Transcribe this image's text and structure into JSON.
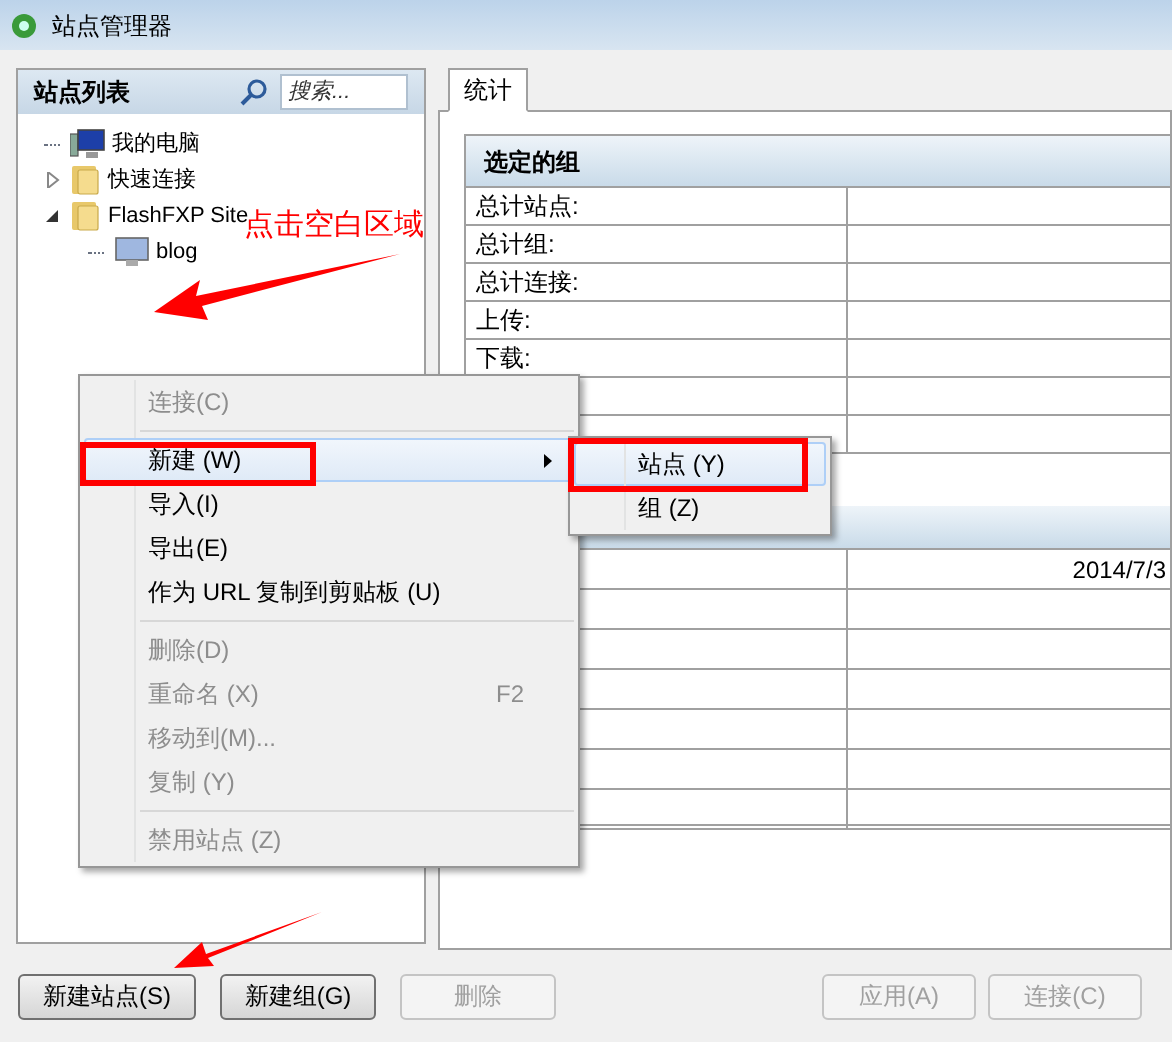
{
  "window": {
    "title": "站点管理器"
  },
  "site_list": {
    "title": "站点列表",
    "search": {
      "placeholder": "搜索..."
    },
    "tree": [
      {
        "label": "我的电脑",
        "kind": "computer"
      },
      {
        "label": "快速连接",
        "kind": "folder",
        "expanded": false
      },
      {
        "label": "FlashFXP Site",
        "kind": "folder",
        "expanded": true,
        "children": [
          {
            "label": "blog",
            "kind": "monitor"
          }
        ]
      }
    ]
  },
  "tabs": [
    {
      "label": "统计",
      "selected": true
    }
  ],
  "stats": {
    "group_title": "选定的组",
    "rows": [
      {
        "label": "总计站点:"
      },
      {
        "label": "总计组:"
      },
      {
        "label": "总计连接:"
      },
      {
        "label": "上传:"
      },
      {
        "label": "下载:"
      }
    ],
    "lower_rows": [
      {
        "value": "2014/7/3"
      }
    ]
  },
  "context_menu": [
    {
      "kind": "item",
      "label": "连接(C)",
      "disabled": true,
      "selected": false
    },
    {
      "kind": "separator"
    },
    {
      "kind": "item",
      "label": "新建 (W)",
      "disabled": false,
      "selected": true,
      "submenu": true
    },
    {
      "kind": "item",
      "label": "导入(I)",
      "disabled": false,
      "selected": false
    },
    {
      "kind": "item",
      "label": "导出(E)",
      "disabled": false,
      "selected": false
    },
    {
      "kind": "item",
      "label": "作为 URL 复制到剪贴板 (U)",
      "disabled": false,
      "selected": false
    },
    {
      "kind": "separator"
    },
    {
      "kind": "item",
      "label": "删除(D)",
      "disabled": true,
      "selected": false
    },
    {
      "kind": "item",
      "label": "重命名 (X)",
      "disabled": true,
      "selected": false,
      "shortcut": "F2"
    },
    {
      "kind": "item",
      "label": "移动到(M)...",
      "disabled": true,
      "selected": false
    },
    {
      "kind": "item",
      "label": "复制 (Y)",
      "disabled": true,
      "selected": false
    },
    {
      "kind": "separator"
    },
    {
      "kind": "item",
      "label": "禁用站点 (Z)",
      "disabled": true,
      "selected": false
    }
  ],
  "submenu": [
    {
      "label": "站点 (Y)",
      "selected": true
    },
    {
      "label": "组 (Z)",
      "selected": false
    }
  ],
  "annotation": {
    "text": "点击空白区域"
  },
  "buttons_left": [
    {
      "label": "新建站点(S)",
      "disabled": false
    },
    {
      "label": "新建组(G)",
      "disabled": false
    },
    {
      "label": "删除",
      "disabled": true
    }
  ],
  "buttons_right": [
    {
      "label": "应用(A)",
      "disabled": true
    },
    {
      "label": "连接(C)",
      "disabled": true
    }
  ]
}
